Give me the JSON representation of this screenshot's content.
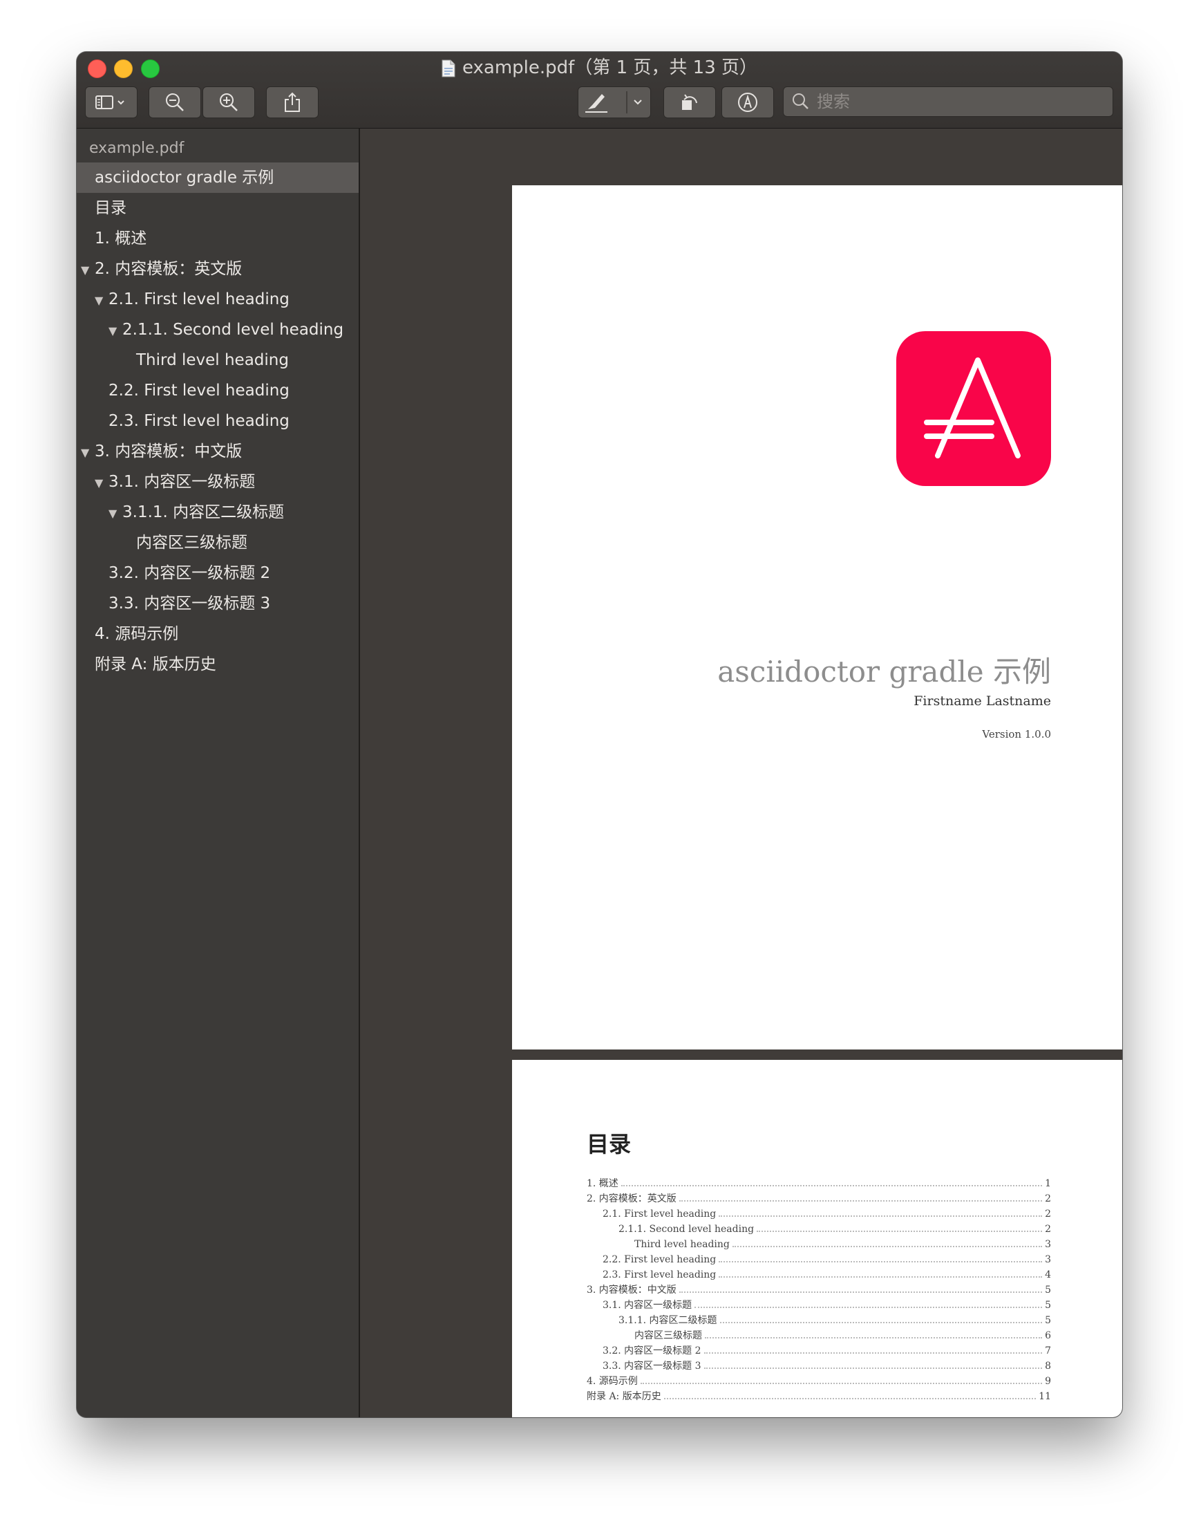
{
  "window": {
    "title": "example.pdf（第 1 页，共 13 页）"
  },
  "toolbar": {
    "sidebar_toggle_icon": "sidebar-icon",
    "zoom_out_icon": "zoom-out-icon",
    "zoom_in_icon": "zoom-in-icon",
    "share_icon": "share-icon",
    "markup_icon": "highlighter-icon",
    "rotate_icon": "rotate-icon",
    "annotate_icon": "markup-pen-icon",
    "search_placeholder": "搜索"
  },
  "sidebar": {
    "file_name": "example.pdf",
    "items": [
      {
        "label": "asciidoctor gradle 示例",
        "level": 0,
        "expanded": null,
        "selected": true
      },
      {
        "label": "目录",
        "level": 0,
        "expanded": null,
        "selected": false
      },
      {
        "label": "1. 概述",
        "level": 0,
        "expanded": null,
        "selected": false
      },
      {
        "label": "2. 内容模板：英文版",
        "level": 0,
        "expanded": true,
        "selected": false
      },
      {
        "label": "2.1. First level heading",
        "level": 1,
        "expanded": true,
        "selected": false
      },
      {
        "label": "2.1.1. Second level heading",
        "level": 2,
        "expanded": true,
        "selected": false
      },
      {
        "label": "Third level heading",
        "level": 3,
        "expanded": null,
        "selected": false
      },
      {
        "label": "2.2. First level heading",
        "level": 1,
        "expanded": null,
        "selected": false
      },
      {
        "label": "2.3. First level heading",
        "level": 1,
        "expanded": null,
        "selected": false
      },
      {
        "label": "3. 内容模板：中文版",
        "level": 0,
        "expanded": true,
        "selected": false
      },
      {
        "label": "3.1. 内容区一级标题",
        "level": 1,
        "expanded": true,
        "selected": false
      },
      {
        "label": "3.1.1. 内容区二级标题",
        "level": 2,
        "expanded": true,
        "selected": false
      },
      {
        "label": "内容区三级标题",
        "level": 3,
        "expanded": null,
        "selected": false
      },
      {
        "label": "3.2. 内容区一级标题 2",
        "level": 1,
        "expanded": null,
        "selected": false
      },
      {
        "label": "3.3. 内容区一级标题 3",
        "level": 1,
        "expanded": null,
        "selected": false
      },
      {
        "label": "4. 源码示例",
        "level": 0,
        "expanded": null,
        "selected": false
      },
      {
        "label": "附录 A: 版本历史",
        "level": 0,
        "expanded": null,
        "selected": false
      }
    ]
  },
  "page1": {
    "title": "asciidoctor gradle 示例",
    "author": "Firstname Lastname",
    "version": "Version 1.0.0",
    "logo_color": "#f90549"
  },
  "page2": {
    "toc_title": "目录",
    "toc": [
      {
        "label": "1. 概述",
        "page": "1",
        "level": 0
      },
      {
        "label": "2. 内容模板：英文版",
        "page": "2",
        "level": 0
      },
      {
        "label": "2.1. First level heading",
        "page": "2",
        "level": 1
      },
      {
        "label": "2.1.1. Second level heading",
        "page": "2",
        "level": 2
      },
      {
        "label": "Third level heading",
        "page": "3",
        "level": 3
      },
      {
        "label": "2.2. First level heading",
        "page": "3",
        "level": 1
      },
      {
        "label": "2.3. First level heading",
        "page": "4",
        "level": 1
      },
      {
        "label": "3. 内容模板：中文版",
        "page": "5",
        "level": 0
      },
      {
        "label": "3.1. 内容区一级标题",
        "page": "5",
        "level": 1
      },
      {
        "label": "3.1.1. 内容区二级标题",
        "page": "5",
        "level": 2
      },
      {
        "label": "内容区三级标题",
        "page": "6",
        "level": 3
      },
      {
        "label": "3.2. 内容区一级标题 2",
        "page": "7",
        "level": 1
      },
      {
        "label": "3.3. 内容区一级标题 3",
        "page": "8",
        "level": 1
      },
      {
        "label": "4. 源码示例",
        "page": "9",
        "level": 0
      },
      {
        "label": "附录 A: 版本历史",
        "page": "11",
        "level": 0
      }
    ]
  }
}
